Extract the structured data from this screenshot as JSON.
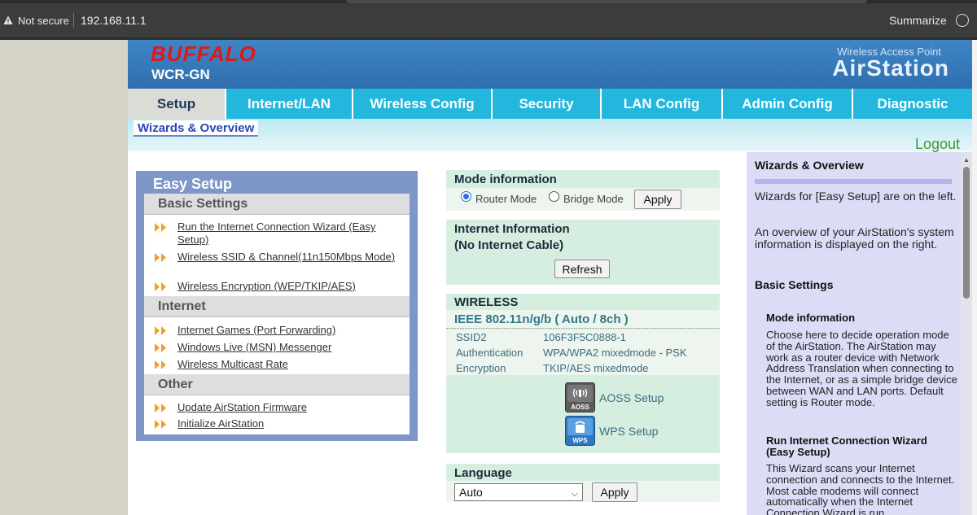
{
  "browser": {
    "security_label": "Not secure",
    "url": "192.168.11.1",
    "summarize_label": "Summarize"
  },
  "header": {
    "brand": "BUFFALO",
    "model": "WCR-GN",
    "product_line": "Wireless Access Point",
    "product_name": "AirStation"
  },
  "nav": {
    "tabs": [
      {
        "label": "Setup",
        "active": true
      },
      {
        "label": "Internet/LAN"
      },
      {
        "label": "Wireless Config"
      },
      {
        "label": "Security"
      },
      {
        "label": "LAN Config"
      },
      {
        "label": "Admin Config"
      },
      {
        "label": "Diagnostic"
      }
    ],
    "sub_item": "Wizards & Overview"
  },
  "logout": "Logout",
  "easy_setup": {
    "title": "Easy Setup",
    "sections": [
      {
        "heading": "Basic Settings",
        "links": [
          "Run the Internet Connection Wizard (Easy Setup)",
          "Wireless SSID & Channel(11n150Mbps Mode)",
          "Wireless Encryption (WEP/TKIP/AES)"
        ]
      },
      {
        "heading": "Internet",
        "links": [
          "Internet Games (Port Forwarding)",
          "Windows Live (MSN) Messenger",
          "Wireless Multicast Rate"
        ]
      },
      {
        "heading": "Other",
        "links": [
          "Update AirStation Firmware",
          "Initialize AirStation"
        ]
      }
    ]
  },
  "mode_info": {
    "title": "Mode information",
    "options": [
      "Router Mode",
      "Bridge Mode"
    ],
    "selected": "Router Mode",
    "apply": "Apply"
  },
  "internet_info": {
    "title": "Internet Information",
    "status": "(No Internet Cable)",
    "refresh": "Refresh"
  },
  "wireless": {
    "title": "WIRELESS",
    "standard": "IEEE 802.11n/g/b ( Auto / 8ch )",
    "rows": [
      {
        "key": "SSID2",
        "value": "106F3F5C0888-1"
      },
      {
        "key": "Authentication",
        "value": "WPA/WPA2 mixedmode - PSK"
      },
      {
        "key": "Encryption",
        "value": "TKIP/AES mixedmode"
      }
    ],
    "aoss_label": "AOSS Setup",
    "aoss_icon_text": "AOSS",
    "wps_label": "WPS Setup",
    "wps_icon_text": "WPS"
  },
  "language": {
    "title": "Language",
    "selected": "Auto",
    "apply": "Apply"
  },
  "help": {
    "title": "Wizards & Overview",
    "p1": "Wizards for [Easy Setup] are on the left.",
    "p2": "An overview of your AirStation's system information is displayed on the right.",
    "basic_heading": "Basic Settings",
    "mode_heading": "Mode information",
    "mode_text": "Choose here to decide operation mode of the AirStation. The AirStation may work as a router device with Network Address Translation when connecting to the Internet, or as a simple bridge device between WAN and LAN ports. Default setting is Router mode.",
    "wizard_heading": "Run Internet Connection Wizard (Easy Setup)",
    "wizard_text": "This Wizard scans your Internet connection and connects to the Internet. Most cable modems will connect automatically when the Internet Connection Wizard is run."
  },
  "colors": {
    "brand_red": "#e0181c",
    "header_blue": "#3f86c6",
    "tab_cyan": "#23b7dd",
    "panel_blue": "#7e97c8",
    "box_green": "#d6eee0",
    "help_lavender": "#dcdcf6",
    "logout_green": "#3a9a34"
  }
}
